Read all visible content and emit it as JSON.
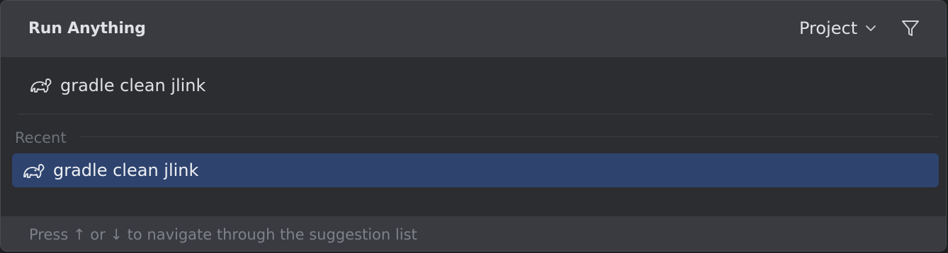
{
  "header": {
    "title": "Run Anything",
    "scope_label": "Project",
    "scope_icon": "chevron-down-icon",
    "filter_icon": "filter-icon"
  },
  "search": {
    "icon": "gradle-elephant-icon",
    "value": "gradle clean jlink"
  },
  "groups": [
    {
      "label": "Recent",
      "items": [
        {
          "icon": "gradle-elephant-icon",
          "label": "gradle clean jlink",
          "selected": true
        }
      ]
    }
  ],
  "footer": {
    "hint": "Press ↑ or ↓ to navigate through the suggestion list"
  },
  "colors": {
    "background": "#2b2d30",
    "header": "#393b40",
    "selection": "#2e436e",
    "text": "#dfe1e5",
    "muted": "#6f737a"
  }
}
